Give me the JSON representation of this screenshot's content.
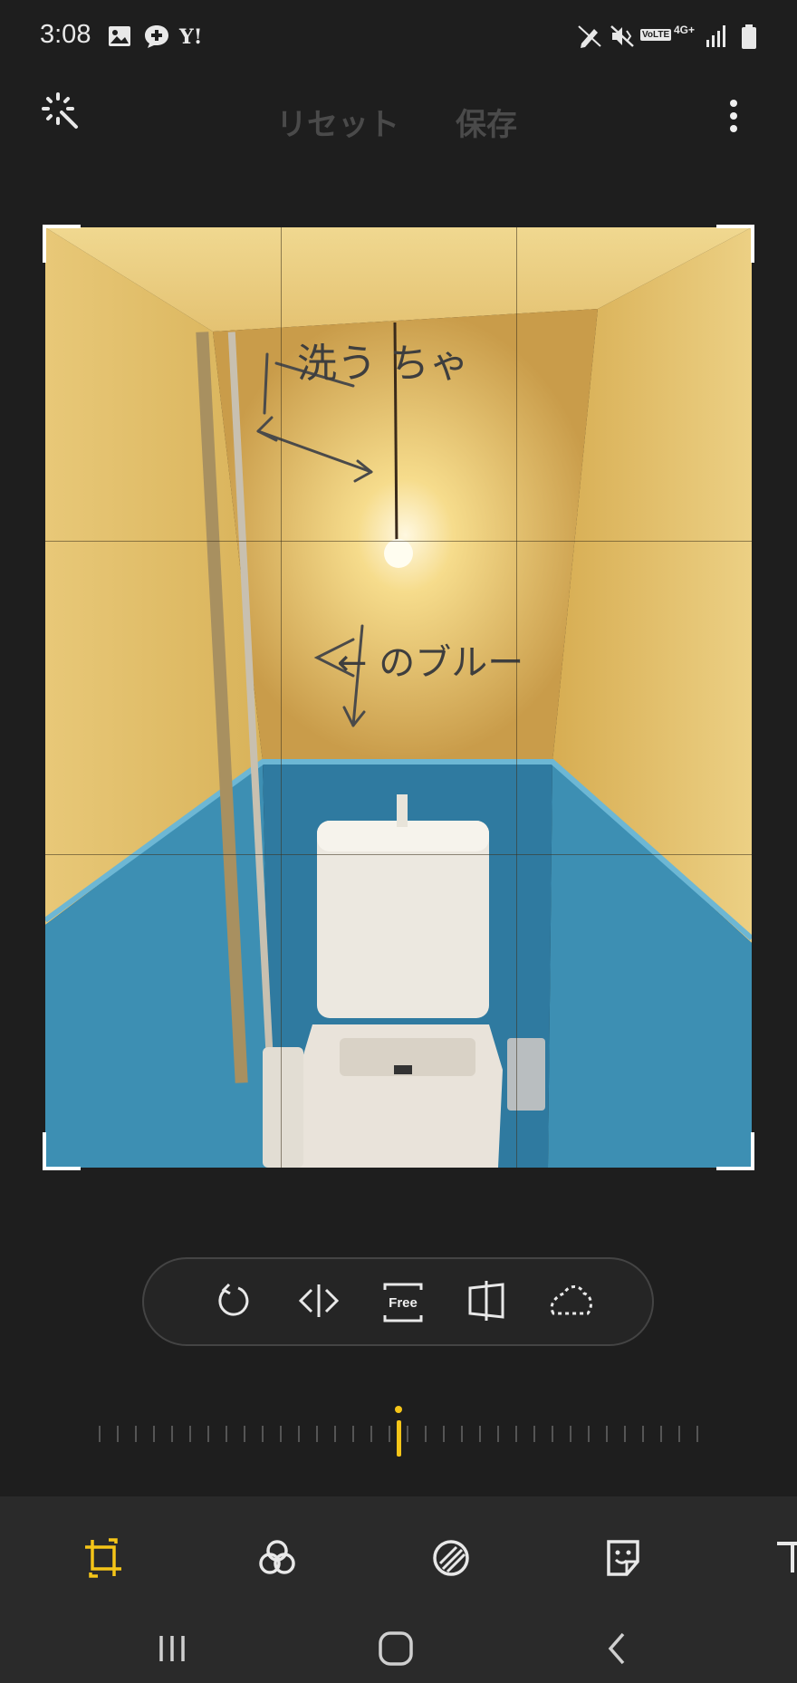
{
  "status_bar": {
    "time": "3:08",
    "left_icons": [
      "image-icon",
      "chat-plus-icon",
      "yahoo-icon"
    ],
    "right_icons": [
      "edit-pen-icon",
      "mute-vibrate-icon",
      "volte-icon",
      "4g-plus-icon",
      "signal-icon",
      "battery-icon"
    ],
    "volte_label": "VoLTE",
    "network_label": "4G+"
  },
  "top_bar": {
    "auto_icon": "auto-adjust-icon",
    "reset_label": "リセット",
    "save_label": "保存",
    "more_icon": "more-vert-icon"
  },
  "photo": {
    "handwriting_top": "洗う ちゃ",
    "handwriting_mid": "← のブルー"
  },
  "crop_tools": {
    "rotate_icon": "rotate-icon",
    "flip_icon": "flip-icon",
    "free_label": "Free",
    "perspective_icon": "perspective-icon",
    "lasso_icon": "lasso-icon"
  },
  "ruler": {
    "value": 0
  },
  "edit_tabs": {
    "active": "crop",
    "items": [
      "crop-rotate-icon",
      "filters-icon",
      "tone-icon",
      "sticker-icon",
      "text-icon"
    ]
  },
  "nav": [
    "recents-icon",
    "home-icon",
    "back-icon"
  ],
  "colors": {
    "accent": "#f5c518",
    "background": "#1e1e1e",
    "disabled_text": "#4a4a4a",
    "bottom_bar": "#2a2a2a"
  }
}
